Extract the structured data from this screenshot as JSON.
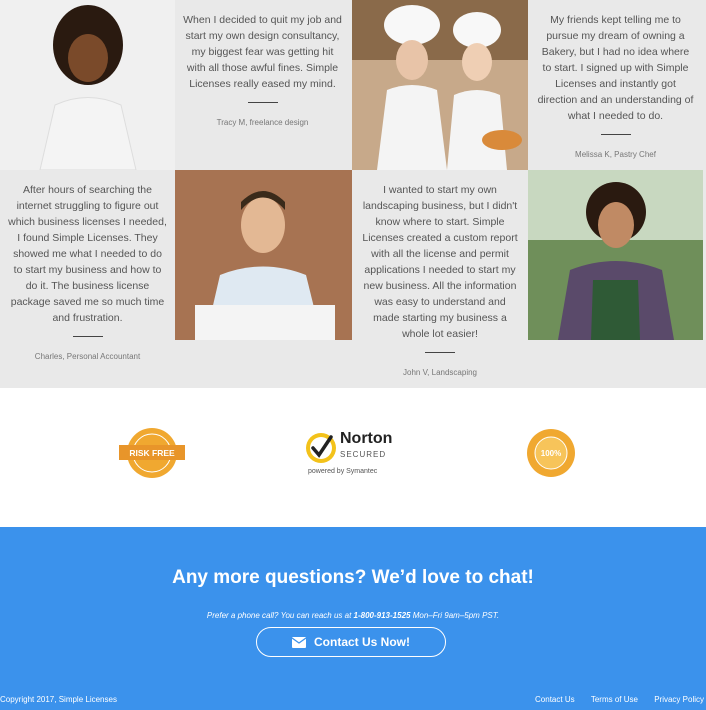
{
  "testimonials": [
    {
      "quote": "When I decided to quit my job and start my own design consultancy, my biggest fear was getting hit with all those awful fines. Simple Licenses really eased my mind.",
      "author": "Tracy M, freelance design"
    },
    {
      "quote": "My friends kept telling me to pursue my dream of owning a Bakery, but I had no idea where to start. I signed up with Simple Licenses and instantly got direction and an understanding of what I needed to do.",
      "author": "Melissa K, Pastry Chef"
    },
    {
      "quote": "After hours of searching the internet struggling to figure out which business licenses I needed, I found Simple Licenses. They showed me what I needed to do to start my business and how to do it. The business license package saved me so much time and frustration.",
      "author": "Charles, Personal Accountant"
    },
    {
      "quote": "I wanted to start my own landscaping business, but I didn't know where to start. Simple Licenses created a custom report with all the license and permit applications I needed to start my new business. All the information was easy to understand and made starting my business a whole lot easier!",
      "author": "John V, Landscaping"
    }
  ],
  "badges": {
    "risk_free": "RISK FREE",
    "risk_free_ring": "SATISFACTION GUARANTEED",
    "norton_brand": "Norton",
    "norton_secured": "SECURED",
    "norton_powered": "powered by Symantec",
    "money_back": "100%",
    "money_back_ring": "MONEY BACK GUARANTEE"
  },
  "cta": {
    "heading": "Any more questions? We’d love to chat!",
    "sub_prefix": "Prefer a phone call? You can reach us at",
    "phone": "1-800-913-1525",
    "sub_suffix": "Mon–Fri 9am–5pm PST.",
    "button_label": "Contact Us Now!"
  },
  "footer": {
    "copyright": "Copyright 2017, Simple Licenses",
    "links": [
      "Contact Us",
      "Terms of Use",
      "Privacy Policy"
    ]
  },
  "colors": {
    "accent": "#3b92ec",
    "badge_gold": "#f0a830"
  }
}
